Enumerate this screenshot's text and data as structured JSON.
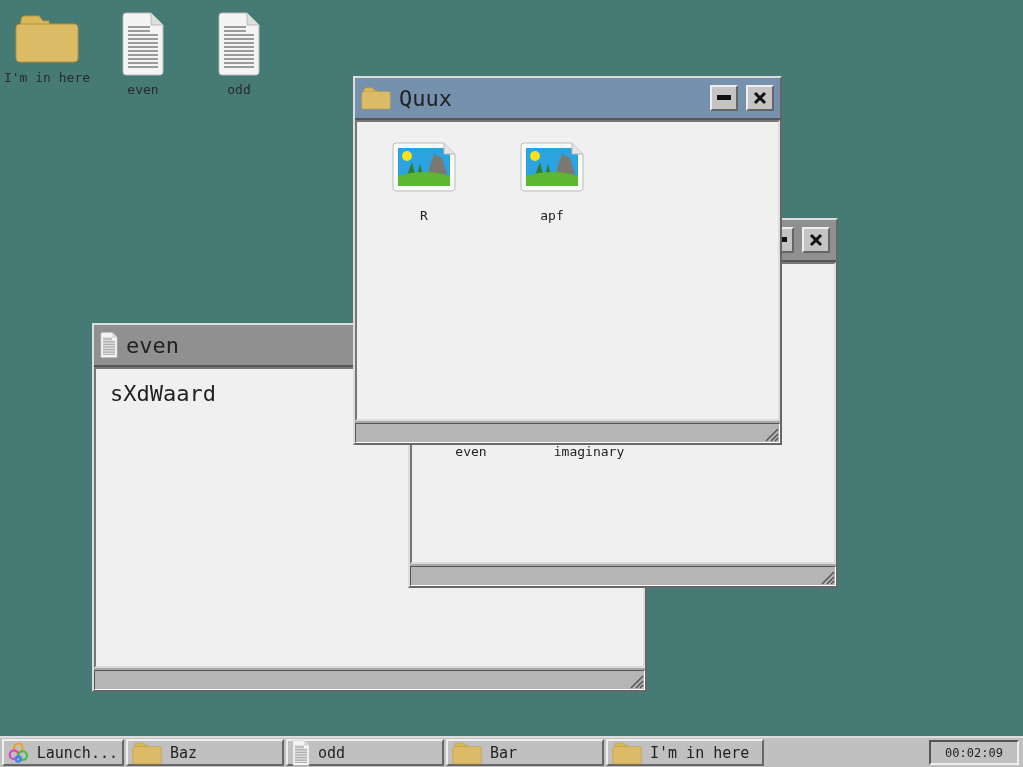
{
  "desktop_icons": [
    {
      "kind": "folder",
      "label": "I'm in here"
    },
    {
      "kind": "document",
      "label": "even"
    },
    {
      "kind": "document",
      "label": "odd"
    }
  ],
  "windows": [
    {
      "kind": "text",
      "title": "even",
      "active": false,
      "text": "sXdWaard"
    },
    {
      "kind": "folder",
      "active": false,
      "items": [
        {
          "label": "even"
        },
        {
          "label": "imaginary"
        }
      ]
    },
    {
      "kind": "folder",
      "title": "Quux",
      "active": true,
      "items": [
        {
          "kind": "image",
          "label": "R"
        },
        {
          "kind": "image",
          "label": "apf"
        }
      ]
    }
  ],
  "taskbar": {
    "launcher": "Launch...",
    "tasks": [
      {
        "kind": "folder",
        "label": "Baz"
      },
      {
        "kind": "document",
        "label": "odd"
      },
      {
        "kind": "folder",
        "label": "Bar"
      },
      {
        "kind": "folder",
        "label": "I'm in here"
      }
    ],
    "clock": "00:02:09"
  }
}
